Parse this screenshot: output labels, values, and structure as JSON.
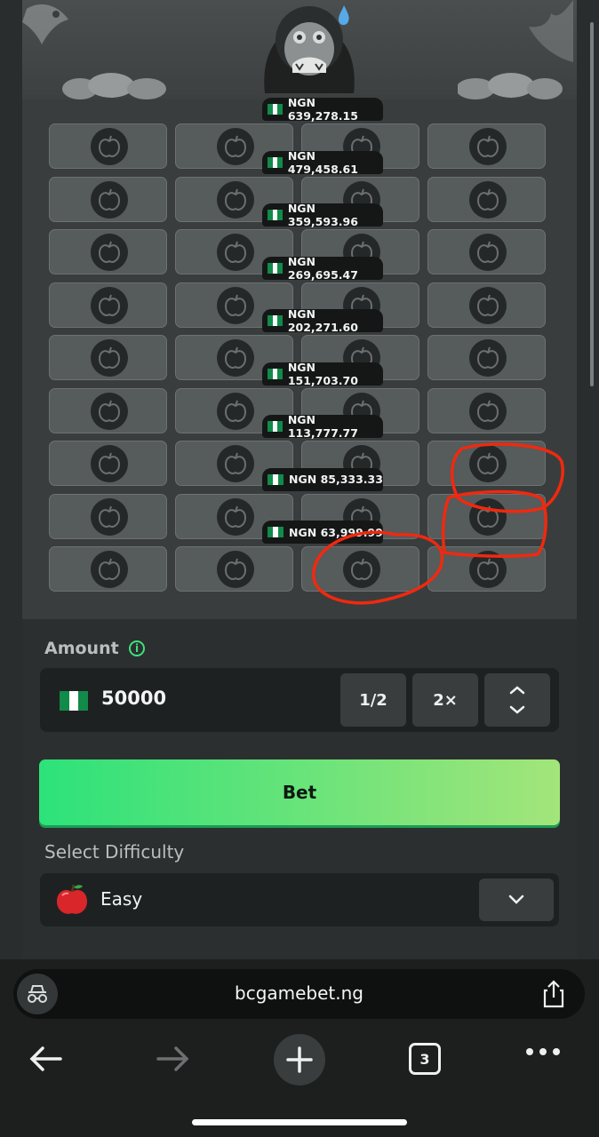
{
  "game": {
    "multipliers": [
      "NGN 639,278.15",
      "NGN 479,458.61",
      "NGN 359,593.96",
      "NGN 269,695.47",
      "NGN 202,271.60",
      "NGN 151,703.70",
      "NGN 113,777.77",
      "NGN 85,333.33",
      "NGN 63,999.99"
    ],
    "rows": 9,
    "columns": 4
  },
  "controls": {
    "amount_label": "Amount",
    "amount_value": "50000",
    "half_label": "1/2",
    "double_label": "2×",
    "bet_label": "Bet",
    "difficulty_label": "Select Difficulty",
    "difficulty_value": "Easy"
  },
  "browser": {
    "url": "bcgamebet.ng",
    "tab_count": "3"
  },
  "colors": {
    "accent_green": "#2de27a",
    "annotation_red": "#f0290f"
  }
}
